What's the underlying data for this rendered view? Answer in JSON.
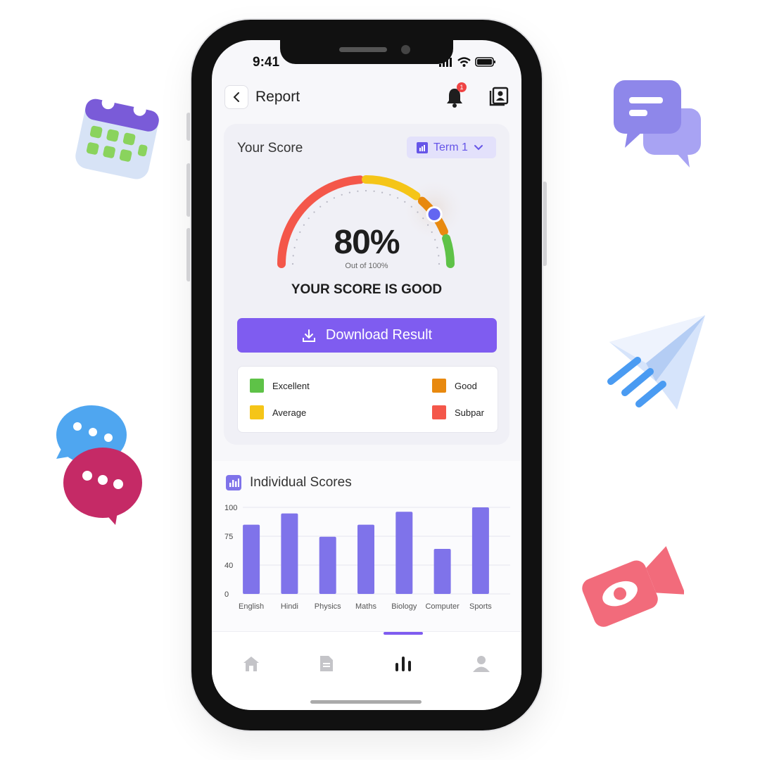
{
  "status_bar": {
    "time": "9:41"
  },
  "header": {
    "title": "Report",
    "notification_count": "1"
  },
  "score_card": {
    "title": "Your Score",
    "term_selector": "Term 1",
    "score_value": "80%",
    "score_subtitle": "Out of 100%",
    "score_fraction": 0.8,
    "verdict": "YOUR SCORE IS GOOD",
    "download_label": "Download Result",
    "legend": [
      {
        "label": "Excellent",
        "color": "#5ec247"
      },
      {
        "label": "Good",
        "color": "#e8890f"
      },
      {
        "label": "Average",
        "color": "#f5c518"
      },
      {
        "label": "Subpar",
        "color": "#f4574a"
      }
    ]
  },
  "individual_scores": {
    "title": "Individual Scores",
    "chart_data": {
      "type": "bar",
      "categories": [
        "English",
        "Hindi",
        "Physics",
        "Maths",
        "Biology",
        "Computer",
        "Sports"
      ],
      "values": [
        80,
        93,
        66,
        80,
        95,
        52,
        100
      ],
      "y_tick_labels": [
        "100",
        "75",
        "40",
        "0"
      ],
      "ylim": [
        0,
        100
      ],
      "grid": true,
      "bar_color": "#7f73ea"
    }
  },
  "bottom_nav": {
    "items": [
      {
        "name": "home-icon",
        "active": false
      },
      {
        "name": "document-icon",
        "active": false
      },
      {
        "name": "bar-chart-icon",
        "active": true
      },
      {
        "name": "profile-icon",
        "active": false
      }
    ]
  },
  "colors": {
    "accent": "#7f5cf0",
    "badge": "#ef4444"
  }
}
